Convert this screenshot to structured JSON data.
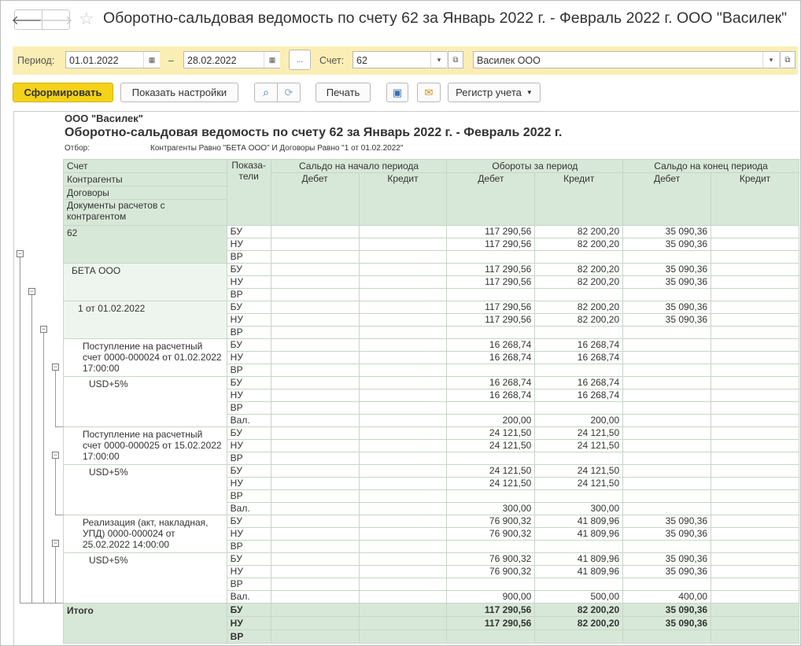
{
  "window": {
    "title": "Оборотно-сальдовая ведомость по счету 62 за Январь 2022 г. - Февраль 2022 г. ООО \"Василек\""
  },
  "params": {
    "period_label": "Период:",
    "date_from": "01.01.2022",
    "dash": "–",
    "date_to": "28.02.2022",
    "more_label": "...",
    "account_label": "Счет:",
    "account_value": "62",
    "org_value": "Василек ООО"
  },
  "toolbar": {
    "generate_label": "Сформировать",
    "settings_label": "Показать настройки",
    "print_label": "Печать",
    "registry_label": "Регистр учета"
  },
  "report": {
    "org": "ООО \"Василек\"",
    "title": "Оборотно-сальдовая ведомость по счету 62 за Январь 2022 г. - Февраль 2022 г.",
    "filter_label": "Отбор:",
    "filter_value": "Контрагенты Равно \"БЕТА ООО\" И Договоры Равно \"1 от 01.02.2022\"",
    "header": {
      "account": "Счет",
      "counterparties": "Контрагенты",
      "contracts": "Договоры",
      "documents": "Документы расчетов с контрагентом",
      "indicators": "Показа-тели",
      "opening": "Сальдо на начало периода",
      "turnover": "Обороты за период",
      "closing": "Сальдо на конец периода",
      "debit": "Дебет",
      "credit": "Кредит"
    },
    "groups": [
      {
        "label": "62",
        "indent": 0,
        "bg": "g",
        "rows": [
          {
            "ind": "БУ",
            "d": "117 290,56",
            "c": "82 200,20",
            "ed": "35 090,36"
          },
          {
            "ind": "НУ",
            "d": "117 290,56",
            "c": "82 200,20",
            "ed": "35 090,36"
          },
          {
            "ind": "ВР",
            "d": "",
            "c": "",
            "ed": ""
          }
        ]
      },
      {
        "label": "БЕТА ООО",
        "indent": 1,
        "bg": "lg",
        "rows": [
          {
            "ind": "БУ",
            "d": "117 290,56",
            "c": "82 200,20",
            "ed": "35 090,36"
          },
          {
            "ind": "НУ",
            "d": "117 290,56",
            "c": "82 200,20",
            "ed": "35 090,36"
          },
          {
            "ind": "ВР",
            "d": "",
            "c": "",
            "ed": ""
          }
        ]
      },
      {
        "label": "1 от 01.02.2022",
        "indent": 2,
        "bg": "lg",
        "rows": [
          {
            "ind": "БУ",
            "d": "117 290,56",
            "c": "82 200,20",
            "ed": "35 090,36"
          },
          {
            "ind": "НУ",
            "d": "117 290,56",
            "c": "82 200,20",
            "ed": "35 090,36"
          },
          {
            "ind": "ВР",
            "d": "",
            "c": "",
            "ed": ""
          }
        ]
      },
      {
        "label": "Поступление на расчетный счет 0000-000024 от 01.02.2022 17:00:00",
        "indent": 3,
        "bg": "",
        "rows": [
          {
            "ind": "БУ",
            "d": "16 268,74",
            "c": "16 268,74",
            "ed": ""
          },
          {
            "ind": "НУ",
            "d": "16 268,74",
            "c": "16 268,74",
            "ed": ""
          },
          {
            "ind": "ВР",
            "d": "",
            "c": "",
            "ed": ""
          }
        ]
      },
      {
        "label": "USD+5%",
        "indent": 4,
        "bg": "",
        "rows": [
          {
            "ind": "БУ",
            "d": "16 268,74",
            "c": "16 268,74",
            "ed": ""
          },
          {
            "ind": "НУ",
            "d": "16 268,74",
            "c": "16 268,74",
            "ed": ""
          },
          {
            "ind": "ВР",
            "d": "",
            "c": "",
            "ed": ""
          },
          {
            "ind": "Вал.",
            "d": "200,00",
            "c": "200,00",
            "ed": ""
          }
        ]
      },
      {
        "label": "Поступление на расчетный счет 0000-000025 от 15.02.2022 17:00:00",
        "indent": 3,
        "bg": "",
        "rows": [
          {
            "ind": "БУ",
            "d": "24 121,50",
            "c": "24 121,50",
            "ed": ""
          },
          {
            "ind": "НУ",
            "d": "24 121,50",
            "c": "24 121,50",
            "ed": ""
          },
          {
            "ind": "ВР",
            "d": "",
            "c": "",
            "ed": ""
          }
        ]
      },
      {
        "label": "USD+5%",
        "indent": 4,
        "bg": "",
        "rows": [
          {
            "ind": "БУ",
            "d": "24 121,50",
            "c": "24 121,50",
            "ed": ""
          },
          {
            "ind": "НУ",
            "d": "24 121,50",
            "c": "24 121,50",
            "ed": ""
          },
          {
            "ind": "ВР",
            "d": "",
            "c": "",
            "ed": ""
          },
          {
            "ind": "Вал.",
            "d": "300,00",
            "c": "300,00",
            "ed": ""
          }
        ]
      },
      {
        "label": "Реализация (акт, накладная, УПД) 0000-000024 от 25.02.2022 14:00:00",
        "indent": 3,
        "bg": "",
        "rows": [
          {
            "ind": "БУ",
            "d": "76 900,32",
            "c": "41 809,96",
            "ed": "35 090,36"
          },
          {
            "ind": "НУ",
            "d": "76 900,32",
            "c": "41 809,96",
            "ed": "35 090,36"
          },
          {
            "ind": "ВР",
            "d": "",
            "c": "",
            "ed": ""
          }
        ]
      },
      {
        "label": "USD+5%",
        "indent": 4,
        "bg": "",
        "rows": [
          {
            "ind": "БУ",
            "d": "76 900,32",
            "c": "41 809,96",
            "ed": "35 090,36"
          },
          {
            "ind": "НУ",
            "d": "76 900,32",
            "c": "41 809,96",
            "ed": "35 090,36"
          },
          {
            "ind": "ВР",
            "d": "",
            "c": "",
            "ed": ""
          },
          {
            "ind": "Вал.",
            "d": "900,00",
            "c": "500,00",
            "ed": "400,00"
          }
        ]
      },
      {
        "label": "Итого",
        "indent": 0,
        "bg": "g",
        "total": true,
        "rows": [
          {
            "ind": "БУ",
            "d": "117 290,56",
            "c": "82 200,20",
            "ed": "35 090,36"
          },
          {
            "ind": "НУ",
            "d": "117 290,56",
            "c": "82 200,20",
            "ed": "35 090,36"
          },
          {
            "ind": "ВР",
            "d": "",
            "c": "",
            "ed": ""
          }
        ]
      }
    ]
  }
}
